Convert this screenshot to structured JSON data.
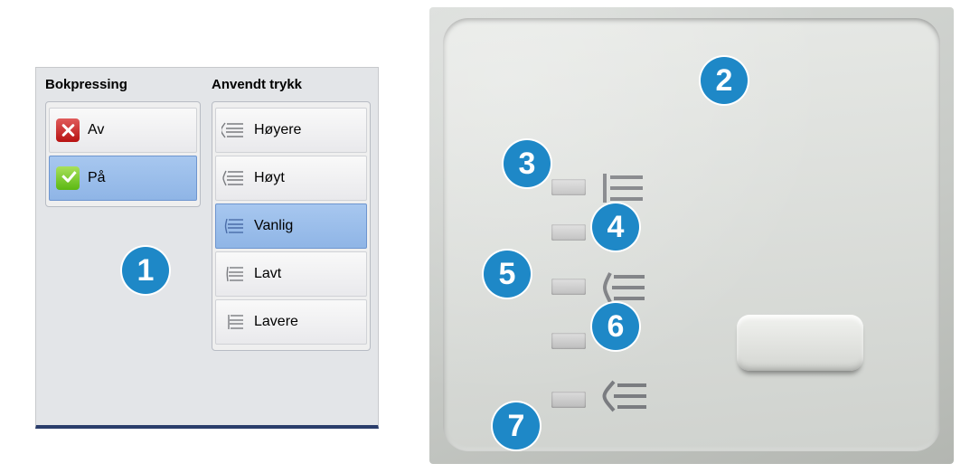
{
  "software_panel": {
    "bokpressing": {
      "title": "Bokpressing",
      "options": [
        {
          "label": "Av",
          "icon": "x-icon",
          "selected": false
        },
        {
          "label": "På",
          "icon": "check-icon",
          "selected": true
        }
      ]
    },
    "anvendt_trykk": {
      "title": "Anvendt trykk",
      "options": [
        {
          "label": "Høyere",
          "selected": false
        },
        {
          "label": "Høyt",
          "selected": false
        },
        {
          "label": "Vanlig",
          "selected": true
        },
        {
          "label": "Lavt",
          "selected": false
        },
        {
          "label": "Lavere",
          "selected": false
        }
      ]
    }
  },
  "callouts": {
    "1": "1",
    "2": "2",
    "3": "3",
    "4": "4",
    "5": "5",
    "6": "6",
    "7": "7"
  }
}
